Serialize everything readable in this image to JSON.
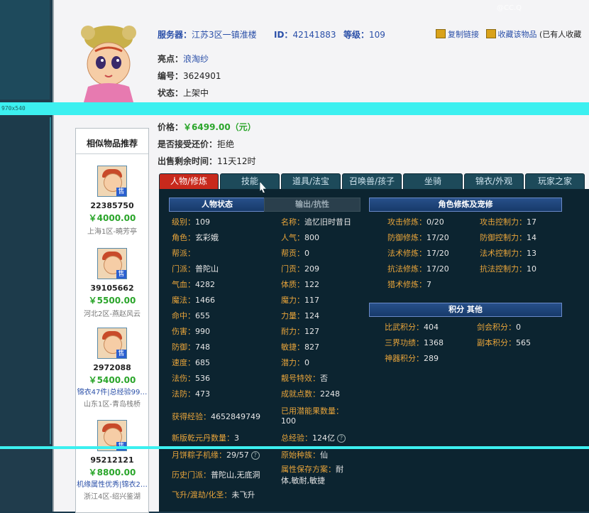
{
  "overlay": {
    "tag": "970x540"
  },
  "watermark": "@CC.Q",
  "header": {
    "server_label": "服务器：",
    "server_value": "江苏3区一镇淮楼",
    "id_label": "ID：",
    "id_value": "42141883",
    "level_label": "等级：",
    "level_value": "109",
    "actions": [
      "复制链接",
      "收藏该物品",
      "(已有人收藏"
    ]
  },
  "detail": {
    "highlight_label": "亮点：",
    "highlight_value": "浪淘纱",
    "serial_label": "编号：",
    "serial_value": "3624901",
    "status_label": "状态：",
    "status_value": "上架中",
    "price_label": "价格：",
    "price_value": "￥6499.00（元）",
    "bargain_label": "是否接受还价：",
    "bargain_value": "拒绝",
    "remaining_label": "出售剩余时间：",
    "remaining_value": "11天12时"
  },
  "sidebar": {
    "title": "相似物品推荐",
    "items": [
      {
        "id": "22385750",
        "price": "￥4000.00",
        "extra": "",
        "server": "上海1区-曉芳亭"
      },
      {
        "id": "39105662",
        "price": "￥5500.00",
        "extra": "",
        "server": "河北2区-燕赵风云"
      },
      {
        "id": "2972088",
        "price": "￥5400.00",
        "extra": "锦衣47件|总经验99…",
        "server": "山东1区-青岛栈桥"
      },
      {
        "id": "95212121",
        "price": "￥8800.00",
        "extra": "机缘属性优秀|锦衣2…",
        "server": "浙江4区-绍兴鉴湖"
      }
    ],
    "sale_badge": "售"
  },
  "tabs": [
    "人物/修炼",
    "技能",
    "道具/法宝",
    "召唤兽/孩子",
    "坐骑",
    "锦衣/外观",
    "玩家之家"
  ],
  "panel": {
    "char_header": "人物状态",
    "resist_header": "输出/抗性",
    "cultivation_header": "角色修炼及宠修",
    "score_header": "积分 其他",
    "left_col": [
      {
        "k": "级别：",
        "v": "109"
      },
      {
        "k": "角色：",
        "v": "玄彩娥"
      },
      {
        "k": "帮派：",
        "v": ""
      },
      {
        "k": "门派：",
        "v": "普陀山"
      },
      {
        "k": "气血：",
        "v": "4282"
      },
      {
        "k": "魔法：",
        "v": "1466"
      },
      {
        "k": "命中：",
        "v": "655"
      },
      {
        "k": "伤害：",
        "v": "990"
      },
      {
        "k": "防御：",
        "v": "748"
      },
      {
        "k": "速度：",
        "v": "685"
      },
      {
        "k": "法伤：",
        "v": "536"
      },
      {
        "k": "法防：",
        "v": "473"
      }
    ],
    "right_col": [
      {
        "k": "名称：",
        "v": "追忆旧时昔日"
      },
      {
        "k": "人气：",
        "v": "800"
      },
      {
        "k": "帮贡：",
        "v": "0"
      },
      {
        "k": "门贡：",
        "v": "209"
      },
      {
        "k": "体质：",
        "v": "122"
      },
      {
        "k": "魔力：",
        "v": "117"
      },
      {
        "k": "力量：",
        "v": "124"
      },
      {
        "k": "耐力：",
        "v": "127"
      },
      {
        "k": "敏捷：",
        "v": "827"
      },
      {
        "k": "潜力：",
        "v": "0"
      },
      {
        "k": "靓号特效：",
        "v": "否"
      },
      {
        "k": "成就点数：",
        "v": "2248"
      }
    ],
    "exp_label": "获得经验：",
    "exp_value": "4652849749",
    "potential_label": "已用潜能果数量：",
    "potential_value": "100",
    "qianyuan_label": "新版乾元丹数量：",
    "qianyuan_value": "3",
    "total_exp_label": "总经验：",
    "total_exp_value": "124亿",
    "zongzi_label": "月饼粽子机缘：",
    "zongzi_value": "29/57",
    "race_label": "原始种族：",
    "race_value": "仙",
    "history_label": "历史门派：",
    "history_value": "普陀山,无底洞",
    "attr_label": "属性保存方案：",
    "attr_value": "耐体,敏耐,敏捷",
    "ascend_label": "飞升/渡劫/化圣：",
    "ascend_value": "未飞升",
    "cultivation": [
      {
        "k": "攻击修炼：",
        "v": "0/20",
        "k2": "攻击控制力：",
        "v2": "17"
      },
      {
        "k": "防御修炼：",
        "v": "17/20",
        "k2": "防御控制力：",
        "v2": "14"
      },
      {
        "k": "法术修炼：",
        "v": "17/20",
        "k2": "法术控制力：",
        "v2": "13"
      },
      {
        "k": "抗法修炼：",
        "v": "17/20",
        "k2": "抗法控制力：",
        "v2": "10"
      },
      {
        "k": "猎术修炼：",
        "v": "7",
        "k2": "",
        "v2": ""
      }
    ],
    "scores": [
      {
        "k": "比武积分：",
        "v": "404",
        "k2": "剑会积分：",
        "v2": "0"
      },
      {
        "k": "三界功绩：",
        "v": "1368",
        "k2": "副本积分：",
        "v2": "565"
      },
      {
        "k": "神器积分：",
        "v": "289",
        "k2": "",
        "v2": ""
      }
    ]
  },
  "colors": {
    "accent": "#c8291c",
    "panel": "#0c2430",
    "price": "#2aa52a",
    "label": "#e8a43a"
  }
}
